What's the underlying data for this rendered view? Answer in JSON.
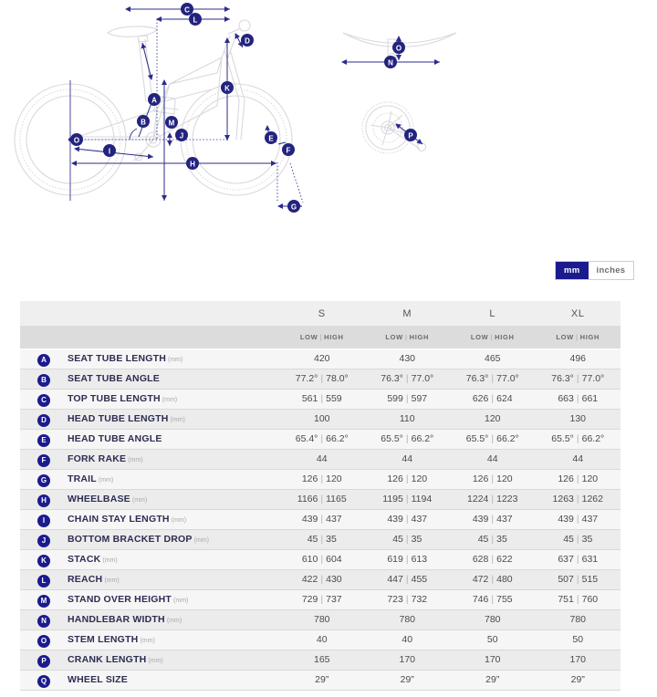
{
  "units": {
    "mm_label": "mm",
    "inches_label": "inches",
    "selected": "mm",
    "accent_color": "#1b1b8f"
  },
  "diagram": {
    "title": "bike-geometry-diagram",
    "markers": [
      "A",
      "B",
      "C",
      "D",
      "E",
      "F",
      "G",
      "H",
      "I",
      "J",
      "K",
      "L",
      "M",
      "N",
      "O",
      "P",
      "Q"
    ],
    "bike_marker_labels": [
      "A",
      "B",
      "C",
      "D",
      "E",
      "F",
      "G",
      "H",
      "I",
      "J",
      "K",
      "L",
      "M",
      "O"
    ],
    "handlebar_marker_labels": [
      "N",
      "O"
    ],
    "crankset_marker_labels": [
      "P"
    ],
    "line_color": "#2b2b8c",
    "outline_color": "#d7d7dd"
  },
  "table": {
    "columns": [
      "S",
      "M",
      "L",
      "XL"
    ],
    "subheader": {
      "low": "LOW",
      "high": "HIGH",
      "separator": "|"
    },
    "rows": [
      {
        "badge": "A",
        "label": "SEAT TUBE LENGTH",
        "unit": "(mm)",
        "values": [
          {
            "single": "420"
          },
          {
            "single": "430"
          },
          {
            "single": "465"
          },
          {
            "single": "496"
          }
        ]
      },
      {
        "badge": "B",
        "label": "SEAT TUBE ANGLE",
        "unit": "",
        "values": [
          {
            "low": "77.2°",
            "high": "78.0°"
          },
          {
            "low": "76.3°",
            "high": "77.0°"
          },
          {
            "low": "76.3°",
            "high": "77.0°"
          },
          {
            "low": "76.3°",
            "high": "77.0°"
          }
        ]
      },
      {
        "badge": "C",
        "label": "TOP TUBE LENGTH",
        "unit": "(mm)",
        "values": [
          {
            "low": "561",
            "high": "559"
          },
          {
            "low": "599",
            "high": "597"
          },
          {
            "low": "626",
            "high": "624"
          },
          {
            "low": "663",
            "high": "661"
          }
        ]
      },
      {
        "badge": "D",
        "label": "HEAD TUBE LENGTH",
        "unit": "(mm)",
        "values": [
          {
            "single": "100"
          },
          {
            "single": "110"
          },
          {
            "single": "120"
          },
          {
            "single": "130"
          }
        ]
      },
      {
        "badge": "E",
        "label": "HEAD TUBE ANGLE",
        "unit": "",
        "values": [
          {
            "low": "65.4°",
            "high": "66.2°"
          },
          {
            "low": "65.5°",
            "high": "66.2°"
          },
          {
            "low": "65.5°",
            "high": "66.2°"
          },
          {
            "low": "65.5°",
            "high": "66.2°"
          }
        ]
      },
      {
        "badge": "F",
        "label": "FORK RAKE",
        "unit": "(mm)",
        "values": [
          {
            "single": "44"
          },
          {
            "single": "44"
          },
          {
            "single": "44"
          },
          {
            "single": "44"
          }
        ]
      },
      {
        "badge": "G",
        "label": "TRAIL",
        "unit": "(mm)",
        "values": [
          {
            "low": "126",
            "high": "120"
          },
          {
            "low": "126",
            "high": "120"
          },
          {
            "low": "126",
            "high": "120"
          },
          {
            "low": "126",
            "high": "120"
          }
        ]
      },
      {
        "badge": "H",
        "label": "WHEELBASE",
        "unit": "(mm)",
        "values": [
          {
            "low": "1166",
            "high": "1165"
          },
          {
            "low": "1195",
            "high": "1194"
          },
          {
            "low": "1224",
            "high": "1223"
          },
          {
            "low": "1263",
            "high": "1262"
          }
        ]
      },
      {
        "badge": "I",
        "label": "CHAIN STAY LENGTH",
        "unit": "(mm)",
        "values": [
          {
            "low": "439",
            "high": "437"
          },
          {
            "low": "439",
            "high": "437"
          },
          {
            "low": "439",
            "high": "437"
          },
          {
            "low": "439",
            "high": "437"
          }
        ]
      },
      {
        "badge": "J",
        "label": "BOTTOM BRACKET DROP",
        "unit": "(mm)",
        "values": [
          {
            "low": "45",
            "high": "35"
          },
          {
            "low": "45",
            "high": "35"
          },
          {
            "low": "45",
            "high": "35"
          },
          {
            "low": "45",
            "high": "35"
          }
        ]
      },
      {
        "badge": "K",
        "label": "STACK",
        "unit": "(mm)",
        "values": [
          {
            "low": "610",
            "high": "604"
          },
          {
            "low": "619",
            "high": "613"
          },
          {
            "low": "628",
            "high": "622"
          },
          {
            "low": "637",
            "high": "631"
          }
        ]
      },
      {
        "badge": "L",
        "label": "REACH",
        "unit": "(mm)",
        "values": [
          {
            "low": "422",
            "high": "430"
          },
          {
            "low": "447",
            "high": "455"
          },
          {
            "low": "472",
            "high": "480"
          },
          {
            "low": "507",
            "high": "515"
          }
        ]
      },
      {
        "badge": "M",
        "label": "STAND OVER HEIGHT",
        "unit": "(mm)",
        "values": [
          {
            "low": "729",
            "high": "737"
          },
          {
            "low": "723",
            "high": "732"
          },
          {
            "low": "746",
            "high": "755"
          },
          {
            "low": "751",
            "high": "760"
          }
        ]
      },
      {
        "badge": "N",
        "label": "HANDLEBAR WIDTH",
        "unit": "(mm)",
        "values": [
          {
            "single": "780"
          },
          {
            "single": "780"
          },
          {
            "single": "780"
          },
          {
            "single": "780"
          }
        ]
      },
      {
        "badge": "O",
        "label": "STEM LENGTH",
        "unit": "(mm)",
        "values": [
          {
            "single": "40"
          },
          {
            "single": "40"
          },
          {
            "single": "50"
          },
          {
            "single": "50"
          }
        ]
      },
      {
        "badge": "P",
        "label": "CRANK LENGTH",
        "unit": "(mm)",
        "values": [
          {
            "single": "165"
          },
          {
            "single": "170"
          },
          {
            "single": "170"
          },
          {
            "single": "170"
          }
        ]
      },
      {
        "badge": "Q",
        "label": "WHEEL SIZE",
        "unit": "",
        "values": [
          {
            "single": "29”"
          },
          {
            "single": "29”"
          },
          {
            "single": "29”"
          },
          {
            "single": "29”"
          }
        ]
      }
    ]
  }
}
